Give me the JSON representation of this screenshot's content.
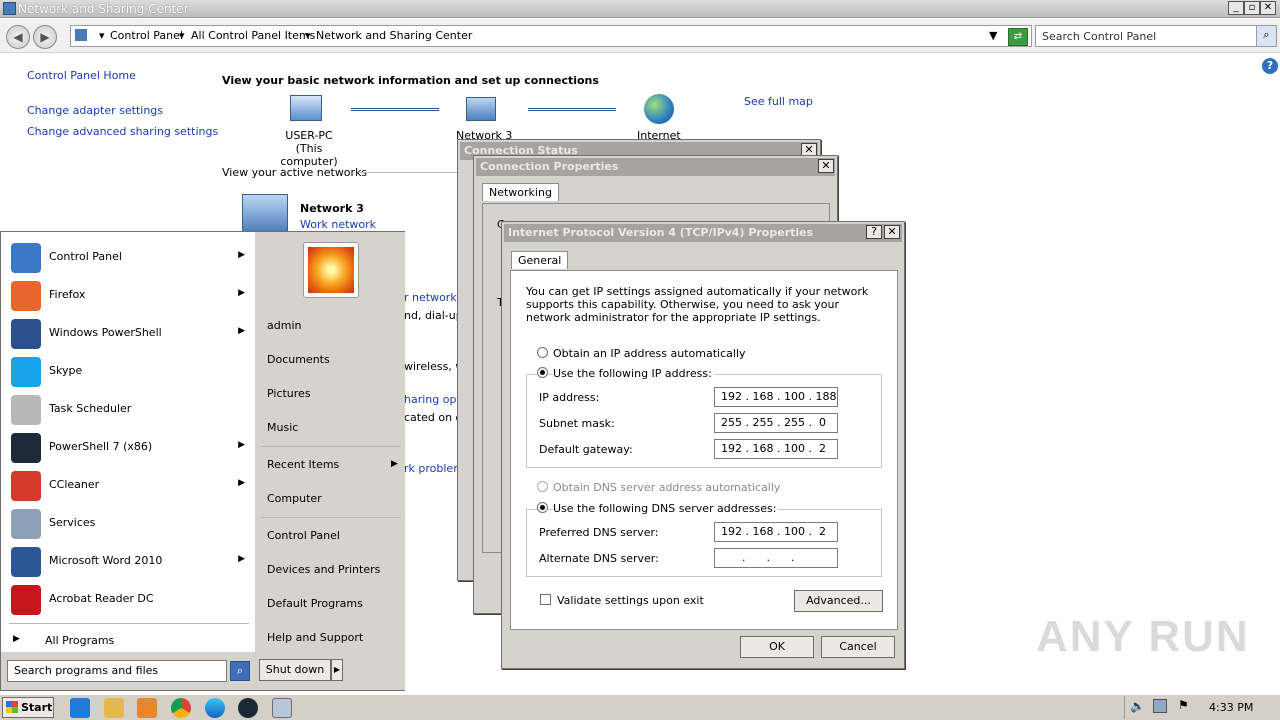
{
  "window": {
    "title": "Network and Sharing Center"
  },
  "address": {
    "crumbs": [
      "Control Panel",
      "All Control Panel Items",
      "Network and Sharing Center"
    ],
    "search_placeholder": "Search Control Panel"
  },
  "left_nav": {
    "home": "Control Panel Home",
    "adapter": "Change adapter settings",
    "advanced": "Change advanced sharing settings"
  },
  "main": {
    "heading": "View your basic network information and set up connections",
    "see_full_map": "See full map",
    "map_nodes": [
      {
        "label": "USER-PC",
        "sub": "(This computer)"
      },
      {
        "label": "Network  3"
      },
      {
        "label": "Internet"
      }
    ],
    "active_networks": "View your active networks",
    "network_name": "Network  3",
    "network_type": "Work network",
    "partial_texts": [
      "r network",
      "nd, dial-up",
      "wireless, w",
      "haring optio",
      "cated on ot",
      "rk problem"
    ]
  },
  "connection_status": {
    "title": "Connection Status",
    "partial": [
      "C",
      "T"
    ]
  },
  "connection_props": {
    "title": "Connection Properties",
    "tab": "Networking"
  },
  "ipv4": {
    "title": "Internet Protocol Version 4 (TCP/IPv4) Properties",
    "help": "?",
    "tab": "General",
    "intro": "You can get IP settings assigned automatically if your network supports this capability. Otherwise, you need to ask your network administrator for the appropriate IP settings.",
    "auto_ip": "Obtain an IP address automatically",
    "manual_ip": "Use the following IP address:",
    "ip_label": "IP address:",
    "ip_value": "192 . 168 . 100 . 188",
    "mask_label": "Subnet mask:",
    "mask_value": "255 . 255 . 255 .  0",
    "gw_label": "Default gateway:",
    "gw_value": "192 . 168 . 100 .  2",
    "auto_dns": "Obtain DNS server address automatically",
    "manual_dns": "Use the following DNS server addresses:",
    "pref_dns_label": "Preferred DNS server:",
    "pref_dns_value": "192 . 168 . 100 .  2",
    "alt_dns_label": "Alternate DNS server:",
    "alt_dns_value": "      .      .      .",
    "validate": "Validate settings upon exit",
    "advanced": "Advanced...",
    "ok": "OK",
    "cancel": "Cancel"
  },
  "start_menu": {
    "programs": [
      {
        "label": "Control Panel",
        "arrow": true,
        "color": "#3a78c8"
      },
      {
        "label": "Firefox",
        "arrow": true,
        "color": "#e8652b"
      },
      {
        "label": "Windows PowerShell",
        "arrow": true,
        "color": "#2a4f8c"
      },
      {
        "label": "Skype",
        "arrow": false,
        "color": "#1aa3e8"
      },
      {
        "label": "Task Scheduler",
        "arrow": false,
        "color": "#b8b8b8"
      },
      {
        "label": "PowerShell 7 (x86)",
        "arrow": true,
        "color": "#1e2a3a"
      },
      {
        "label": "CCleaner",
        "arrow": true,
        "color": "#d33a2a"
      },
      {
        "label": "Services",
        "arrow": false,
        "color": "#8ea0b5"
      },
      {
        "label": "Microsoft Word 2010",
        "arrow": true,
        "color": "#2b5797"
      },
      {
        "label": "Acrobat Reader DC",
        "arrow": false,
        "color": "#c4161c"
      }
    ],
    "all_programs": "All Programs",
    "search_placeholder": "Search programs and files",
    "right": {
      "user": "admin",
      "documents": "Documents",
      "pictures": "Pictures",
      "music": "Music",
      "recent": "Recent Items",
      "computer": "Computer",
      "control_panel": "Control Panel",
      "devices": "Devices and Printers",
      "default_programs": "Default Programs",
      "help": "Help and Support"
    },
    "shutdown": "Shut down"
  },
  "taskbar": {
    "start": "Start",
    "clock": "4:33 PM"
  },
  "watermark": "ANY RUN"
}
